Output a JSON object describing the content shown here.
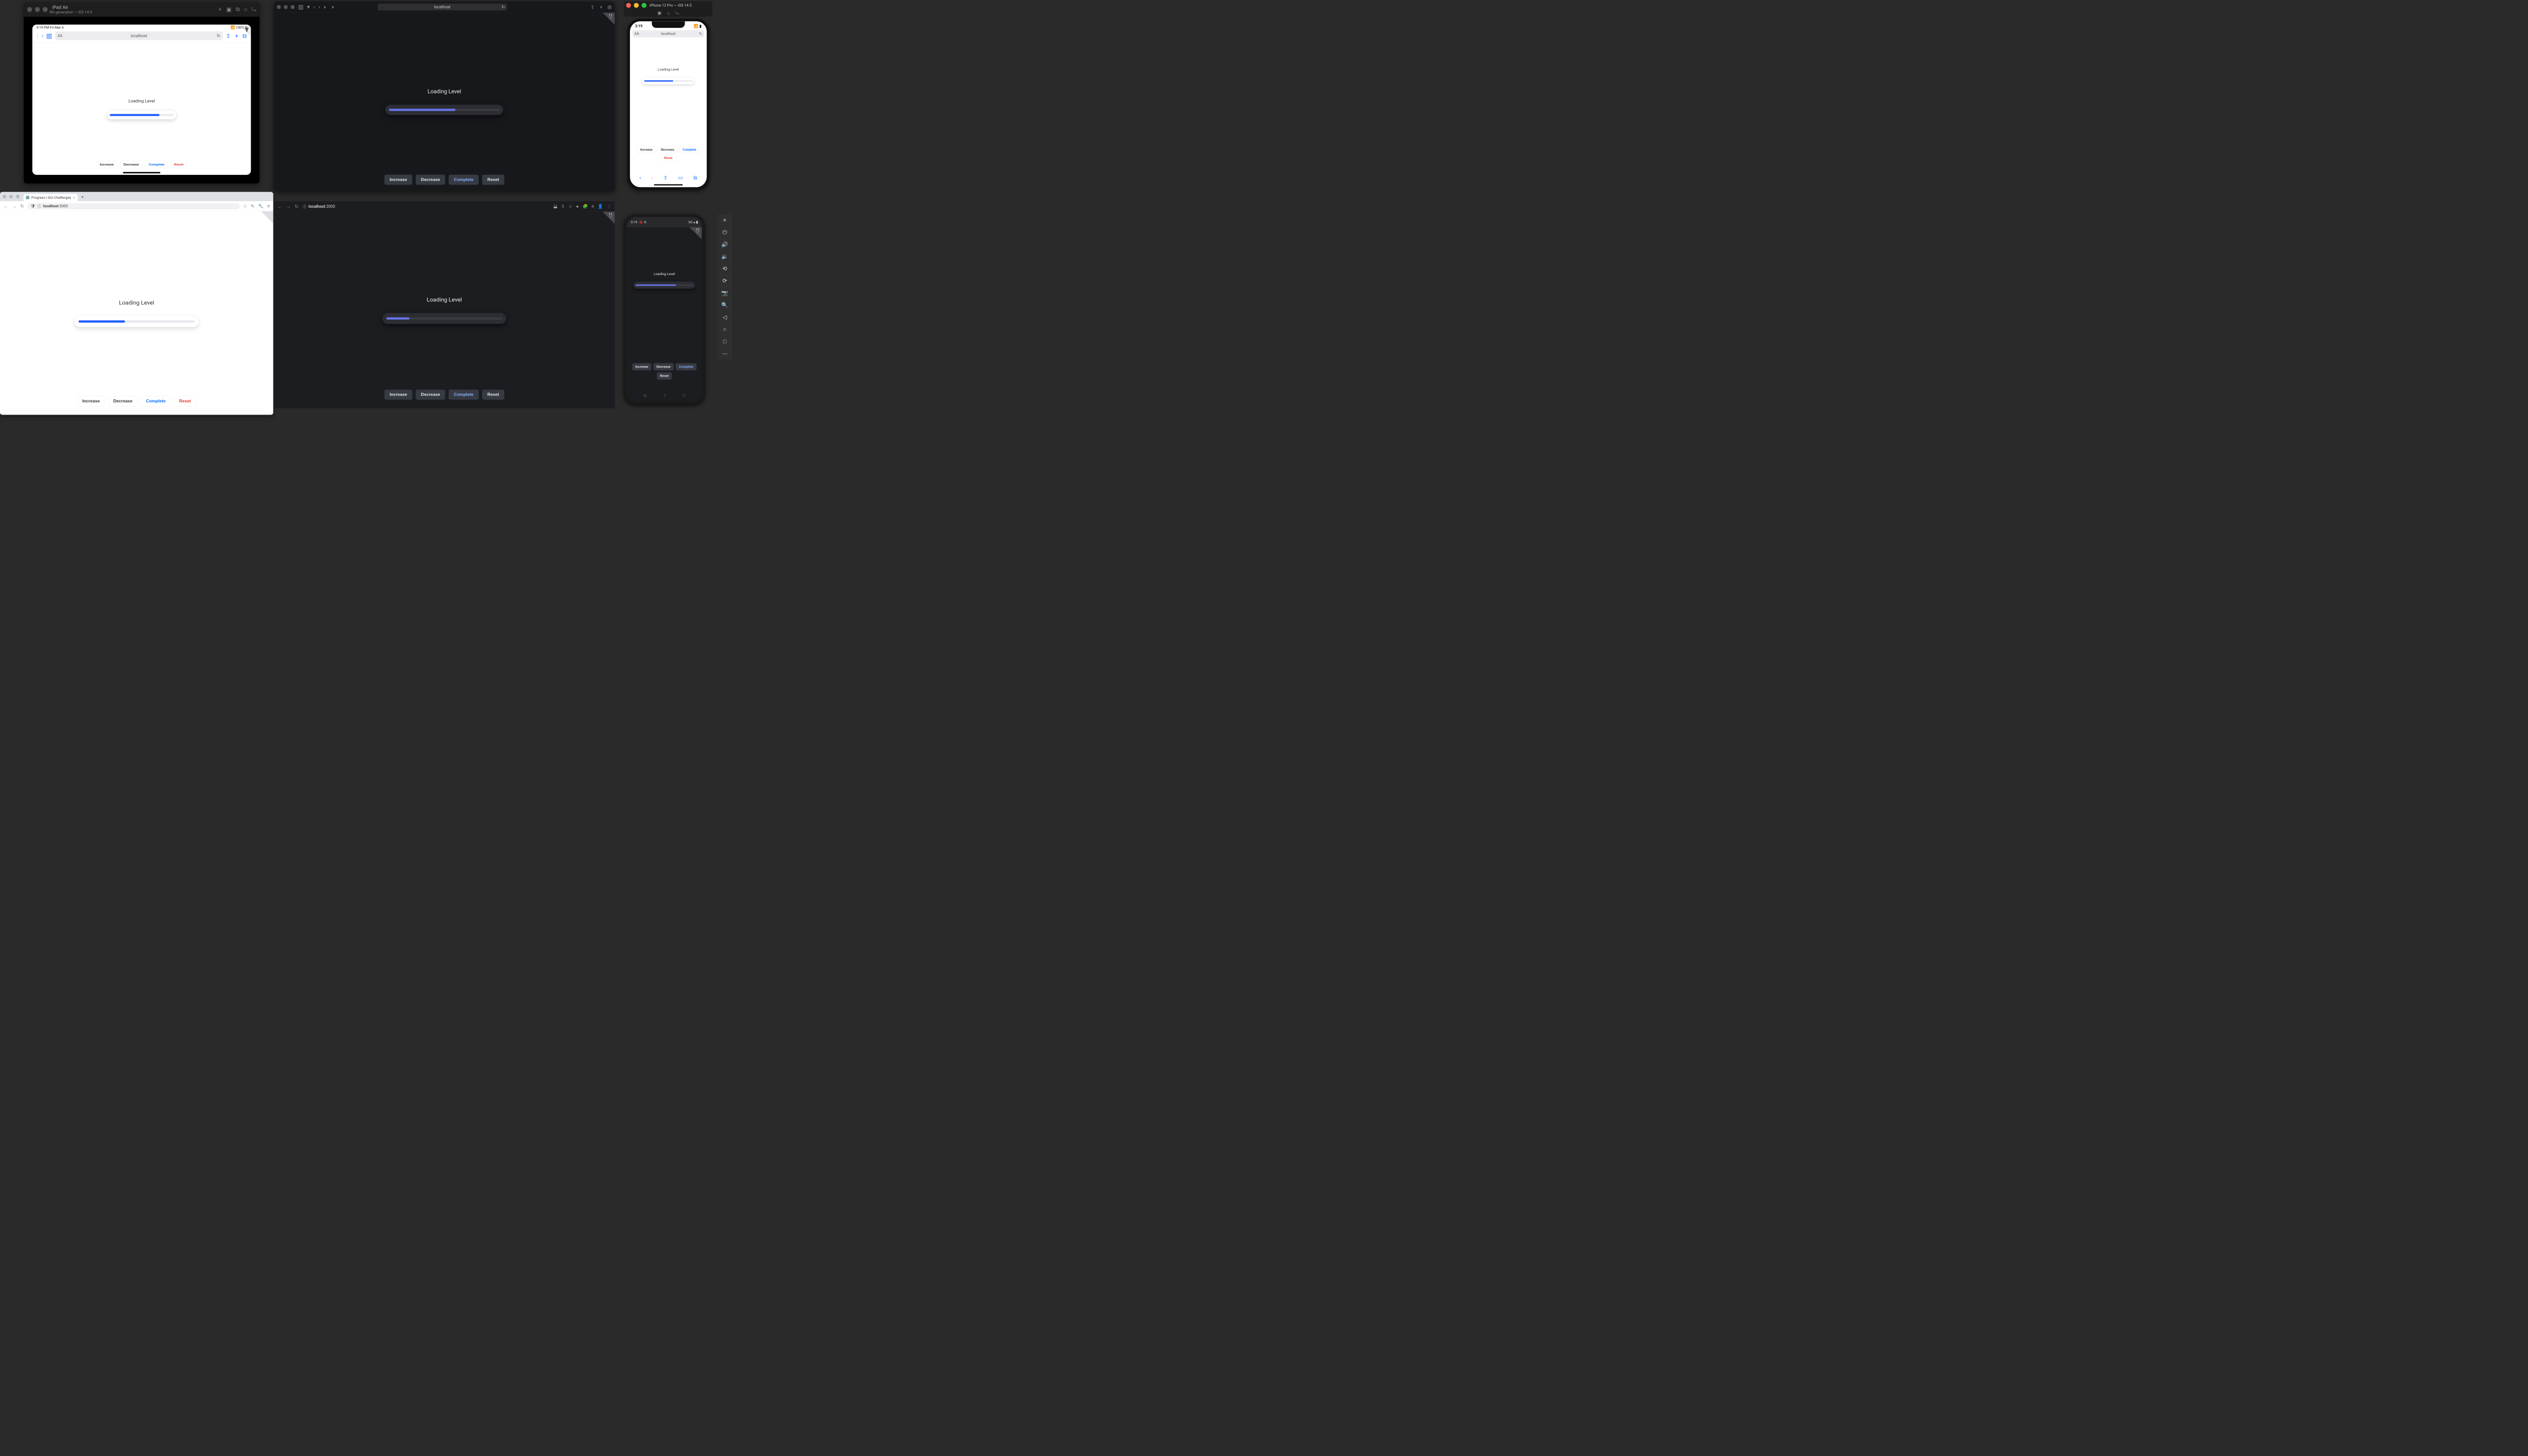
{
  "common": {
    "loading_label": "Loading Level",
    "url_host": "localhost",
    "url_port": ":3000",
    "buttons": {
      "increase": "Increase",
      "decrease": "Decrease",
      "complete": "Complete",
      "reset": "Reset"
    }
  },
  "ipad": {
    "device": "iPad Air",
    "subtitle": "4th generation — iOS 14.5",
    "status_left": "9:19 PM  Fri Mar 4",
    "status_right": "100%",
    "progress_pct": 78
  },
  "safari_dark": {
    "progress_pct": 60
  },
  "iphone": {
    "device": "iPhone 12 Pro — iOS 14.5",
    "time": "3:19",
    "progress_pct": 60
  },
  "chrome_light": {
    "tab_title": "Progress | GUI Challenges",
    "progress_pct": 40
  },
  "chrome_dark": {
    "progress_pct": 20
  },
  "android": {
    "time": "3:19",
    "debug": "🐞 8",
    "progress_pct": 70
  }
}
